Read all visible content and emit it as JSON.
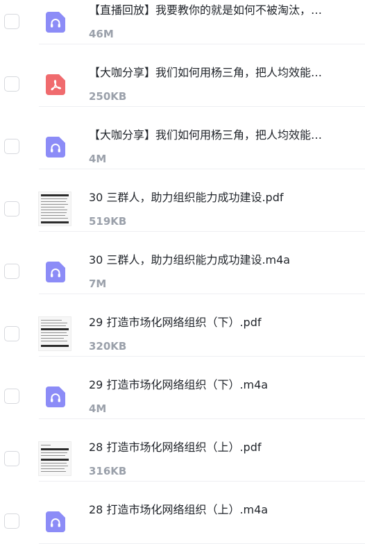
{
  "files": [
    {
      "type": "audio",
      "name": "【直播回放】我要教你的就是如何不被淘汰，以及如何不被淘汰",
      "size": "46M"
    },
    {
      "type": "pdf-icon",
      "name": "【大咖分享】我们如何用杨三角，把人均效能提升",
      "size": "250KB"
    },
    {
      "type": "audio",
      "name": "【大咖分享】我们如何用杨三角，把人均效能提升",
      "size": "4M"
    },
    {
      "type": "pdf-thumb",
      "name": "30 三群人，助力组织能力成功建设.pdf",
      "size": "519KB"
    },
    {
      "type": "audio",
      "name": "30 三群人，助力组织能力成功建设.m4a",
      "size": "7M"
    },
    {
      "type": "pdf-thumb",
      "name": "29 打造市场化网络组织（下）.pdf",
      "size": "320KB"
    },
    {
      "type": "audio",
      "name": "29 打造市场化网络组织（下）.m4a",
      "size": "4M"
    },
    {
      "type": "pdf-thumb",
      "name": "28 打造市场化网络组织（上）.pdf",
      "size": "316KB"
    },
    {
      "type": "audio",
      "name": "28 打造市场化网络组织（上）.m4a",
      "size": ""
    }
  ],
  "colors": {
    "audio_icon": "#8c8cf7",
    "pdf_icon": "#f06b6e"
  }
}
